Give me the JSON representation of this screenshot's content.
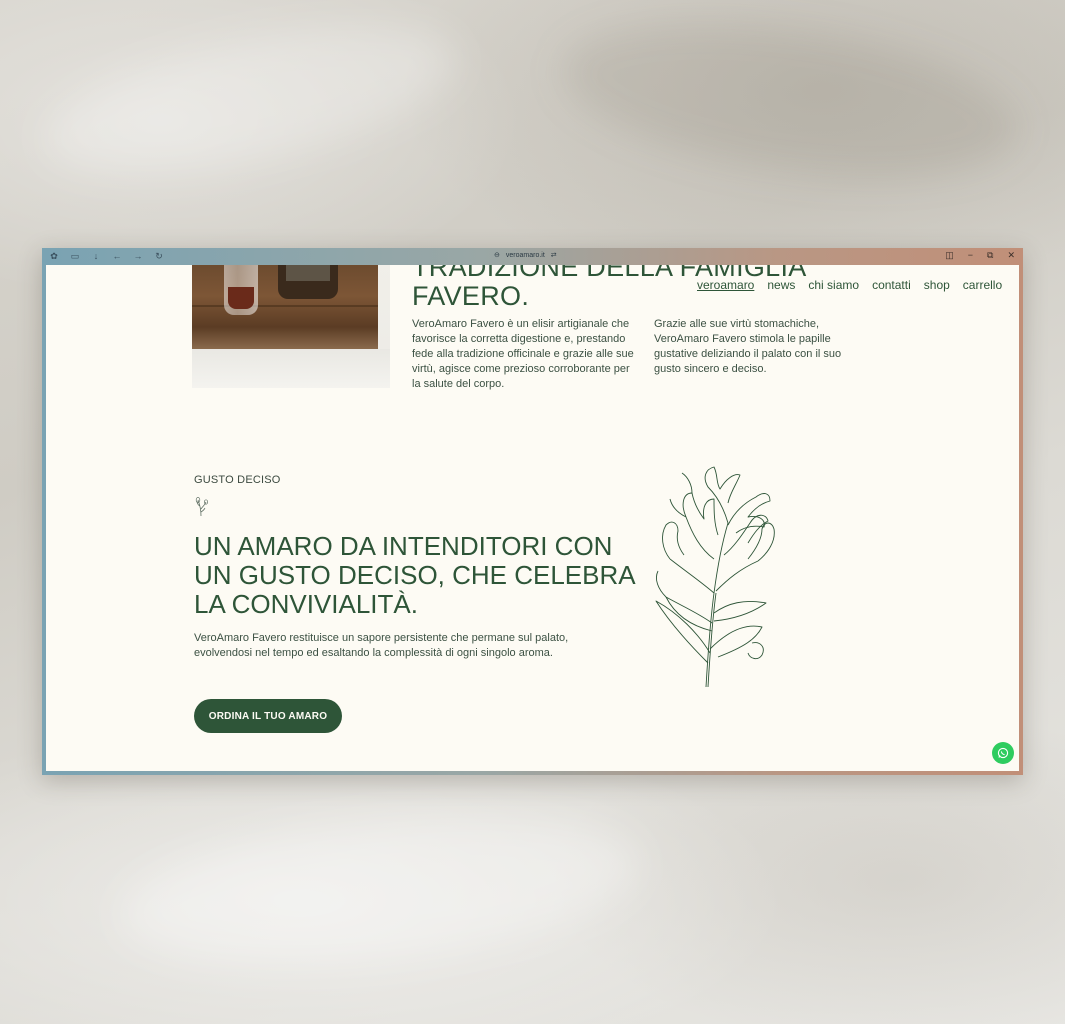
{
  "browser": {
    "url": "veroamaro.it",
    "icons": [
      "extensions-icon",
      "tabs-icon",
      "download-icon",
      "back-icon",
      "forward-icon",
      "reload-icon"
    ]
  },
  "nav": {
    "items": [
      "veroamaro",
      "news",
      "chi siamo",
      "contatti",
      "shop",
      "carrello"
    ],
    "active": "veroamaro"
  },
  "hero": {
    "title_line1": "TRADIZIONE DELLA FAMIGLIA",
    "title_line2": "FAVERO.",
    "para1": "VeroAmaro Favero è un elisir artigianale che favorisce la corretta digestione e, prestando fede alla tradizione officinale e grazie alle sue virtù, agisce come prezioso corroborante per la salute del corpo.",
    "para2": "Grazie alle sue virtù stomachiche, VeroAmaro Favero stimola le papille gustative deliziando il palato con il suo gusto sincero e deciso."
  },
  "section": {
    "eyebrow": "GUSTO DECISO",
    "heading": "UN AMARO DA INTENDITORI CON UN GUSTO DECISO, CHE CELEBRA LA CONVIVIALITÀ.",
    "body": "VeroAmaro Favero restituisce un sapore persistente che permane sul palato, evolvendosi nel tempo ed esaltando la complessità di ogni singolo aroma.",
    "cta": "ORDINA IL TUO AMARO"
  },
  "colors": {
    "brand_green": "#2e5538",
    "page_bg": "#fdfbf4",
    "whatsapp": "#2ecc5f"
  }
}
